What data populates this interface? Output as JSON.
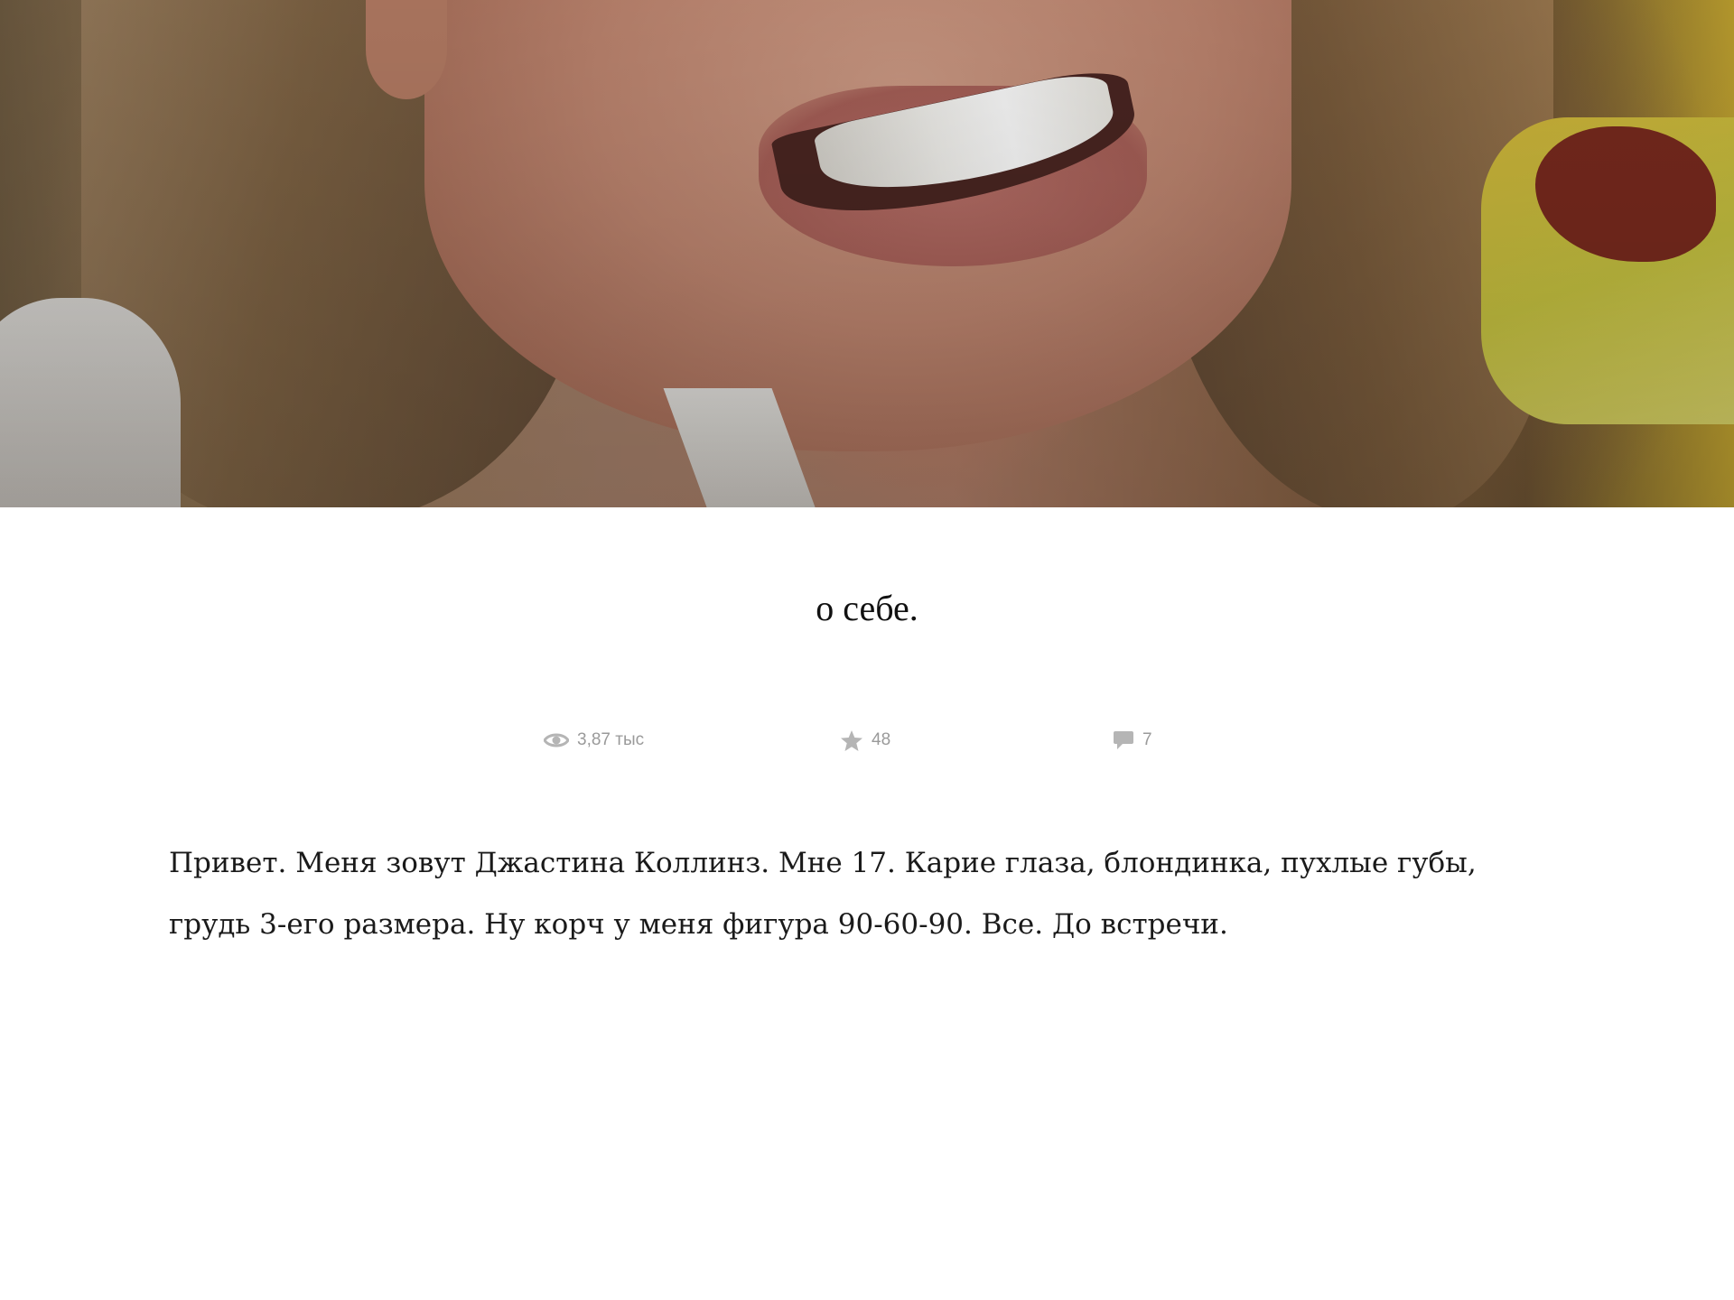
{
  "post": {
    "title": "о себе.",
    "stats": {
      "views": "3,87 тыс",
      "likes": "48",
      "comments": "7"
    },
    "body": "Привет. Меня зовут Джастина Коллинз. Мне 17. Карие глаза, блондинка, пухлые губы, грудь 3-его размера. Ну корч у меня фигура 90-60-90. Все. До встречи."
  },
  "icons": {
    "views": "eye-icon",
    "likes": "star-icon",
    "comments": "comment-bubble-icon"
  },
  "colors": {
    "stats_text": "#9a9a9a",
    "body_text": "#1a1a1a"
  }
}
